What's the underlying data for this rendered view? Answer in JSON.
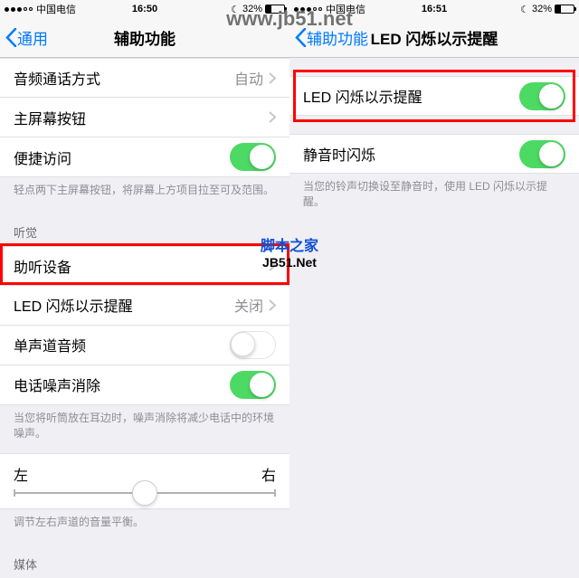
{
  "watermark": {
    "top": "www.jb51.net",
    "mid_cn": "脚本之家",
    "mid_en": "JB51.Net"
  },
  "left": {
    "status": {
      "carrier": "中国电信",
      "time": "16:50",
      "battery_pct": "32%",
      "battery_fill": 32
    },
    "nav": {
      "back": "通用",
      "title": "辅助功能"
    },
    "rows": {
      "audio_call": {
        "label": "音频通话方式",
        "value": "自动"
      },
      "home_button": {
        "label": "主屏幕按钮"
      },
      "easy_access": {
        "label": "便捷访问"
      },
      "easy_note": "轻点两下主屏幕按钮，将屏幕上方项目拉至可及范围。",
      "hearing_header": "听觉",
      "hearing_devices": {
        "label": "助听设备"
      },
      "led_flash": {
        "label": "LED 闪烁以示提醒",
        "value": "关闭"
      },
      "mono_audio": {
        "label": "单声道音频"
      },
      "phone_noise": {
        "label": "电话噪声消除"
      },
      "noise_note": "当您将听筒放在耳边时，噪声消除将减少电话中的环境噪声。",
      "balance_left": "左",
      "balance_right": "右",
      "balance_note": "调节左右声道的音量平衡。",
      "media_header": "媒体"
    }
  },
  "right": {
    "status": {
      "carrier": "中国电信",
      "time": "16:51",
      "battery_pct": "32%",
      "battery_fill": 32
    },
    "nav": {
      "back": "辅助功能",
      "title": "LED 闪烁以示提醒"
    },
    "rows": {
      "led_flash": {
        "label": "LED 闪烁以示提醒"
      },
      "silent_flash": {
        "label": "静音时闪烁"
      },
      "silent_note": "当您的铃声切换设至静音时，使用 LED 闪烁以示提醒。"
    }
  }
}
